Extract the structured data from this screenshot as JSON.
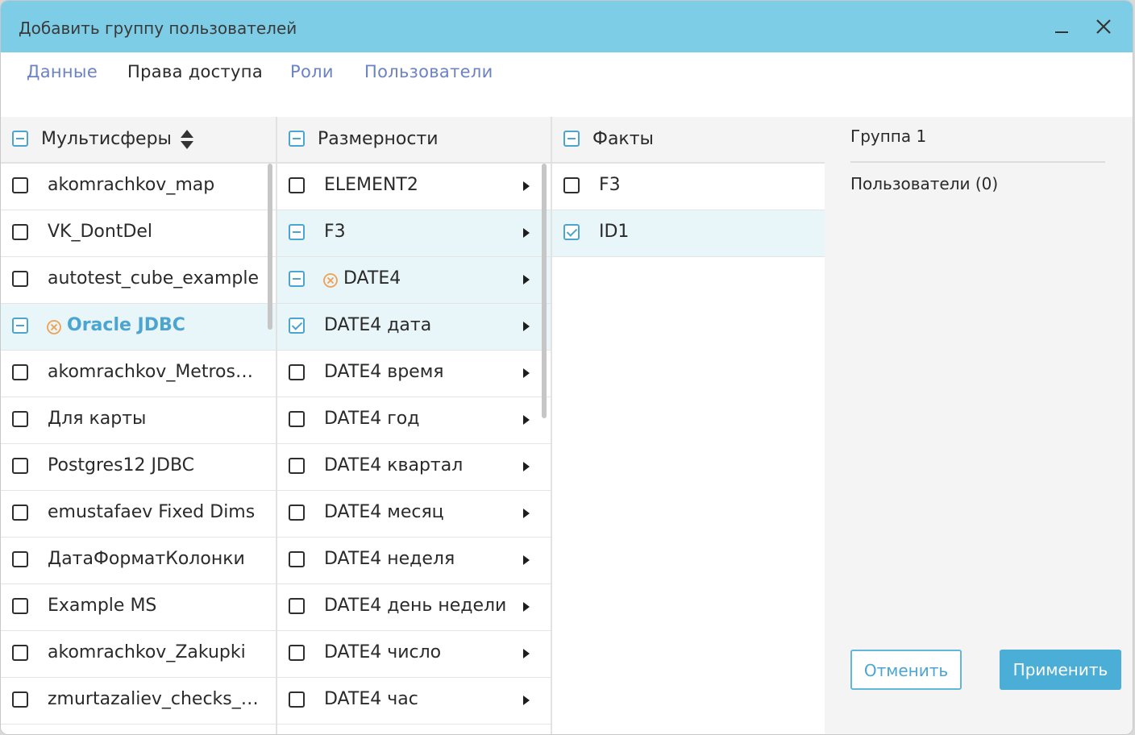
{
  "dialog": {
    "title": "Добавить группу пользователей"
  },
  "tabs": [
    {
      "label": "Данные",
      "active": false
    },
    {
      "label": "Права доступа",
      "active": true
    },
    {
      "label": "Роли",
      "active": false
    },
    {
      "label": "Пользователи",
      "active": false
    }
  ],
  "multispheres": {
    "header": "Мультисферы",
    "header_state": "partial",
    "items": [
      {
        "label": "akomrachkov_map",
        "state": "unchecked"
      },
      {
        "label": "VK_DontDel",
        "state": "unchecked"
      },
      {
        "label": "autotest_cube_example",
        "state": "unchecked"
      },
      {
        "label": "Oracle JDBC",
        "state": "partial",
        "warning": true,
        "selected": true
      },
      {
        "label": "akomrachkov_Metrostroy",
        "state": "unchecked"
      },
      {
        "label": "Для карты",
        "state": "unchecked"
      },
      {
        "label": "Postgres12 JDBC",
        "state": "unchecked"
      },
      {
        "label": "emustafaev Fixed Dims",
        "state": "unchecked"
      },
      {
        "label": "ДатаФорматКолонки",
        "state": "unchecked"
      },
      {
        "label": "Example MS",
        "state": "unchecked"
      },
      {
        "label": "akomrachkov_Zakupki",
        "state": "unchecked"
      },
      {
        "label": "zmurtazaliev_checks_test",
        "state": "unchecked"
      }
    ]
  },
  "dimensions": {
    "header": "Размерности",
    "header_state": "partial",
    "items": [
      {
        "label": "ELEMENT2",
        "state": "unchecked"
      },
      {
        "label": "F3",
        "state": "partial",
        "selected": true
      },
      {
        "label": "DATE4",
        "state": "partial",
        "warning": true,
        "selected": true
      },
      {
        "label": "DATE4 дата",
        "state": "checked",
        "selected": true
      },
      {
        "label": "DATE4 время",
        "state": "unchecked"
      },
      {
        "label": "DATE4 год",
        "state": "unchecked"
      },
      {
        "label": "DATE4 квартал",
        "state": "unchecked"
      },
      {
        "label": "DATE4 месяц",
        "state": "unchecked"
      },
      {
        "label": "DATE4 неделя",
        "state": "unchecked"
      },
      {
        "label": "DATE4 день недели",
        "state": "unchecked"
      },
      {
        "label": "DATE4 число",
        "state": "unchecked"
      },
      {
        "label": "DATE4 час",
        "state": "unchecked"
      }
    ]
  },
  "facts": {
    "header": "Факты",
    "header_state": "partial",
    "items": [
      {
        "label": "F3",
        "state": "unchecked"
      },
      {
        "label": "ID1",
        "state": "checked",
        "selected": true
      }
    ]
  },
  "side_panel": {
    "group_name": "Группа 1",
    "users_label": "Пользователи (0)",
    "cancel_label": "Отменить",
    "apply_label": "Применить"
  },
  "colors": {
    "title_bar": "#7ecde6",
    "accent": "#4ba5d0",
    "warning": "#f0a050",
    "tab_link": "#6b82c4",
    "apply_button": "#4aaed6"
  },
  "icons": {
    "sort": "sort-updown-icon",
    "warning": "circle-x-warning-icon",
    "expand": "chevron-right-icon",
    "minimize": "minimize-icon",
    "close": "close-icon"
  }
}
